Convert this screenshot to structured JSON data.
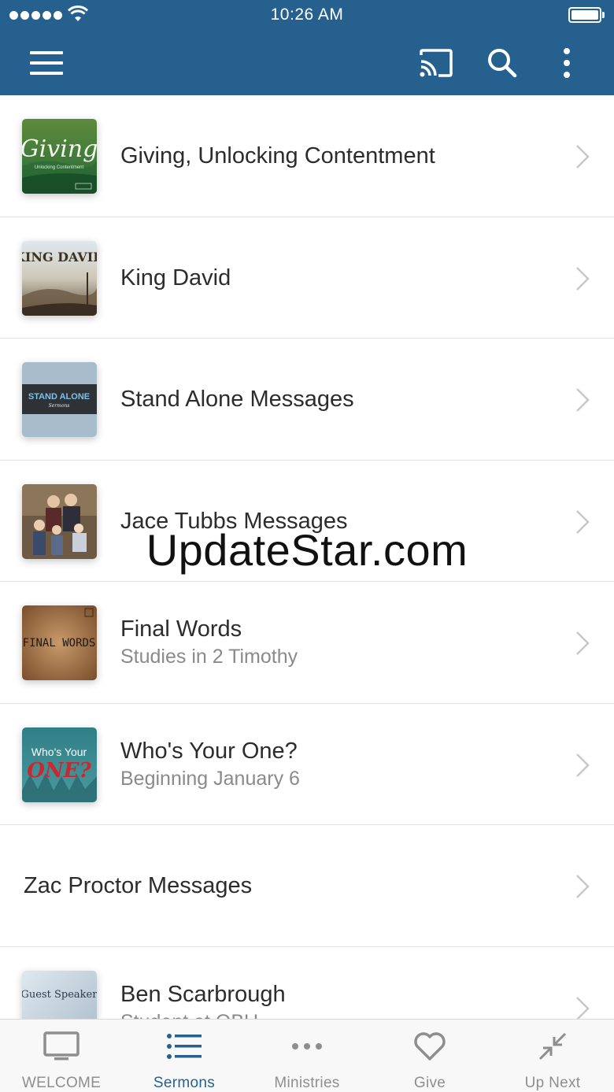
{
  "status_bar": {
    "time": "10:26 AM"
  },
  "nav": {
    "menu_icon": "hamburger-icon",
    "cast_icon": "cast-icon",
    "search_icon": "search-icon",
    "more_icon": "more-vertical-icon"
  },
  "colors": {
    "header": "#26608f",
    "accent": "#26608f",
    "tab_inactive": "#8e8e8e"
  },
  "series": [
    {
      "title": "Giving, Unlocking Contentment",
      "subtitle": "",
      "thumb_text": "Giving",
      "thumb_subtext": "Unlocking Contentment"
    },
    {
      "title": "King David",
      "subtitle": "",
      "thumb_text": "KING DAVID"
    },
    {
      "title": "Stand Alone Messages",
      "subtitle": "",
      "thumb_text": "STAND ALONE",
      "thumb_subtext": "Sermons"
    },
    {
      "title": "Jace Tubbs Messages",
      "subtitle": ""
    },
    {
      "title": "Final Words",
      "subtitle": "Studies in 2 Timothy",
      "thumb_text": "FINAL WORDS"
    },
    {
      "title": "Who's Your One?",
      "subtitle": "Beginning January 6",
      "thumb_text": "Who's Your",
      "thumb_text2": "ONE?"
    },
    {
      "title": "Zac Proctor Messages",
      "subtitle": ""
    },
    {
      "title": "Ben Scarbrough",
      "subtitle": "Student at OBU",
      "thumb_text": "Guest Speaker"
    }
  ],
  "watermark": "UpdateStar.com",
  "tabs": [
    {
      "label": "WELCOME",
      "icon": "tv-icon",
      "active": false
    },
    {
      "label": "Sermons",
      "icon": "list-icon",
      "active": true
    },
    {
      "label": "Ministries",
      "icon": "dots-icon",
      "active": false
    },
    {
      "label": "Give",
      "icon": "heart-icon",
      "active": false
    },
    {
      "label": "Up Next",
      "icon": "collapse-icon",
      "active": false
    }
  ]
}
